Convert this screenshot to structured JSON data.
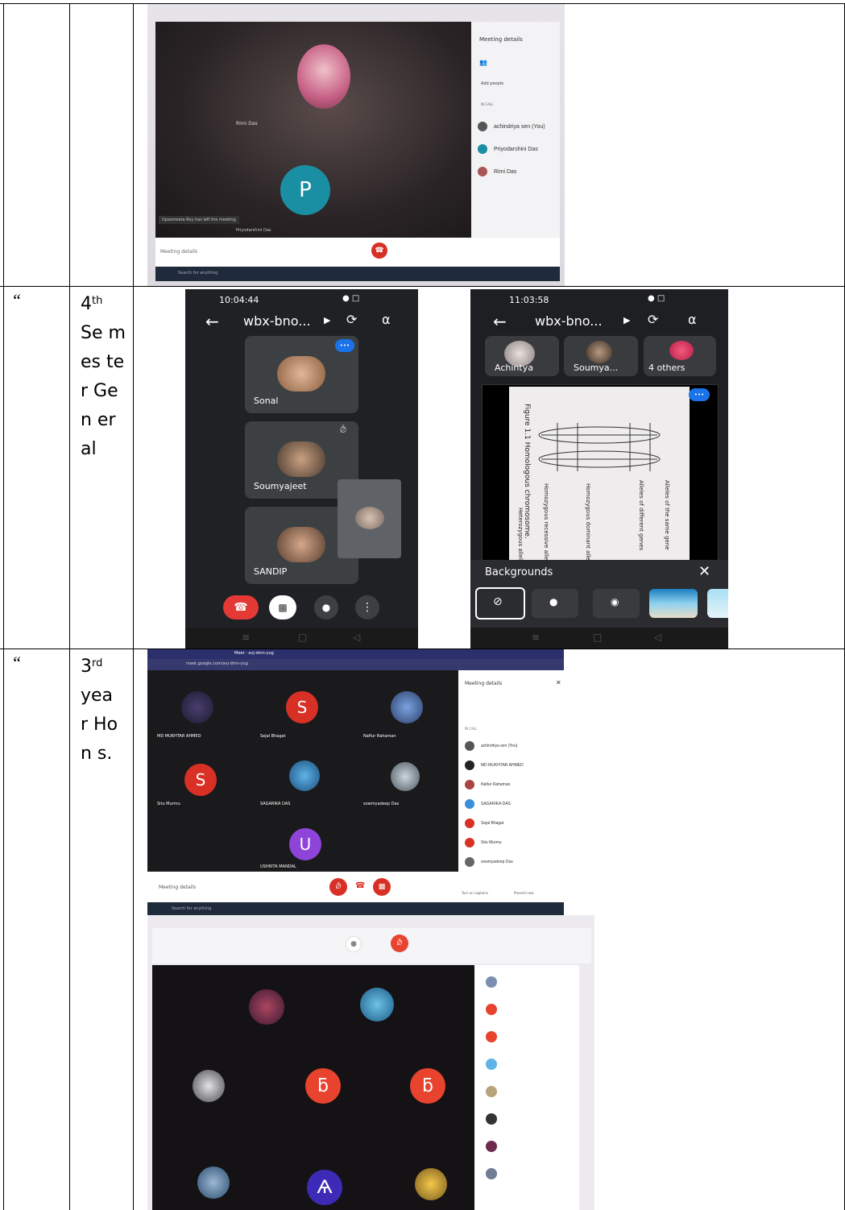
{
  "rows": [
    {
      "ditto": "",
      "semester": "",
      "sup": "",
      "semester_rest": "",
      "photo": {
        "panel_title": "Meeting details",
        "add_people": "Add people",
        "in_call": "IN CALL",
        "participants": [
          "achindriya sen (You)",
          "Priyodarshini Das",
          "Rimi Das"
        ],
        "tile_name_1": "Rimi Das",
        "tile_name_2": "Priyodarshini Das",
        "avatar_letter": "P",
        "toast": "Upasmeeta Roy has left the meeting",
        "bottom_left": "Meeting details",
        "search": "Search for anything"
      }
    },
    {
      "ditto": "“",
      "semester": "4",
      "sup": "th",
      "semester_rest": "Se mes ter Gen eral",
      "phone1": {
        "time": "10:04:44",
        "title": "wbx-bno...",
        "tiles": [
          "Sonal",
          "Soumyajeet",
          "SANDIP"
        ]
      },
      "phone2": {
        "time": "11:03:58",
        "title": "wbx-bno...",
        "participants": [
          "Achintya",
          "Soumya...",
          "4 others"
        ],
        "backgrounds_label": "Backgrounds",
        "figure_caption": "Figure 1.1  Homologous chromosome.",
        "figure_labels": [
          "Heterozygous alleles",
          "Homozygous recessive alleles",
          "Homozygous dominant alleles",
          "Alleles of different genes",
          "Alleles of the same gene"
        ]
      }
    },
    {
      "ditto": "“",
      "semester": "3",
      "sup": "rd",
      "semester_rest": "yea r Hon s.",
      "browser": {
        "tab1": "Meet - avj-dmn-yug",
        "url": "meet.google.com/avj-dmn-yug",
        "panel_title": "Meeting details",
        "in_call": "IN CALL",
        "tiles": [
          {
            "name": "MD MUKHTAR AHMED",
            "letter": ""
          },
          {
            "name": "Sejal Bhagat",
            "letter": "S"
          },
          {
            "name": "Nafiur Rahaman",
            "letter": ""
          },
          {
            "name": "Situ Murmu",
            "letter": "S"
          },
          {
            "name": "SAGARIKA DAS",
            "letter": ""
          },
          {
            "name": "sowmyadeep Das",
            "letter": ""
          },
          {
            "name": "USHRITA MANDAL",
            "letter": "U"
          }
        ],
        "participants": [
          "achindriya sen (You)",
          "MD MUKHTAR AHMED",
          "Nafiur Rahaman",
          "SAGARIKA DAS",
          "Sejal Bhagat",
          "Situ Murmu",
          "sowmyadeep Das"
        ],
        "bottom_left": "Meeting details",
        "captions": "Turn on captions",
        "present": "Present now",
        "search": "Search for anything"
      }
    }
  ]
}
